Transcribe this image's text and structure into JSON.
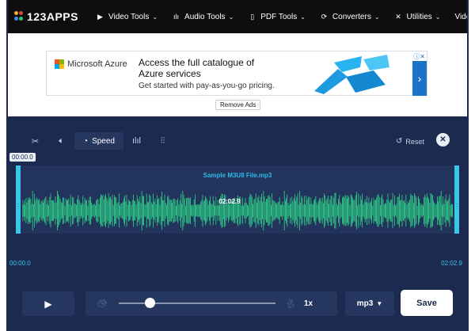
{
  "app": {
    "logo_text": "123APPS"
  },
  "nav": {
    "items": [
      {
        "label": "Video Tools",
        "icon": "video-icon"
      },
      {
        "label": "Audio Tools",
        "icon": "audio-wave-icon"
      },
      {
        "label": "PDF Tools",
        "icon": "pdf-file-icon"
      },
      {
        "label": "Converters",
        "icon": "converter-icon"
      },
      {
        "label": "Utilities",
        "icon": "tools-icon"
      },
      {
        "label": "Video Editor"
      }
    ]
  },
  "ad": {
    "brand": "Microsoft Azure",
    "headline": "Access the full catalogue of Azure services",
    "subtext": "Get started with pay-as-you-go pricing.",
    "remove_label": "Remove Ads"
  },
  "editor": {
    "tools": [
      {
        "name": "cut",
        "icon": "scissors-icon"
      },
      {
        "name": "volume",
        "icon": "speaker-icon"
      },
      {
        "name": "speed",
        "icon": "speed-icon",
        "label": "Speed",
        "active": true
      },
      {
        "name": "equalizer",
        "icon": "waveform-icon"
      },
      {
        "name": "adjust",
        "icon": "sliders-icon"
      }
    ],
    "reset_label": "Reset",
    "file_name": "Sample M3U8 File.mp3",
    "start_badge": "00:00.0",
    "center_time": "02:02.9",
    "start_time": "00:00.0",
    "end_time": "02:02.9",
    "speed_value": "1x",
    "speed_level": 0.2,
    "format": "mp3",
    "save_label": "Save"
  },
  "colors": {
    "nav_bg": "#0e0e0f",
    "editor_bg": "#1b2a4e",
    "panel_bg": "#25365f",
    "wave": "#2fd88a",
    "accent": "#39c7e8",
    "ad_arrow": "#1a73c9"
  }
}
